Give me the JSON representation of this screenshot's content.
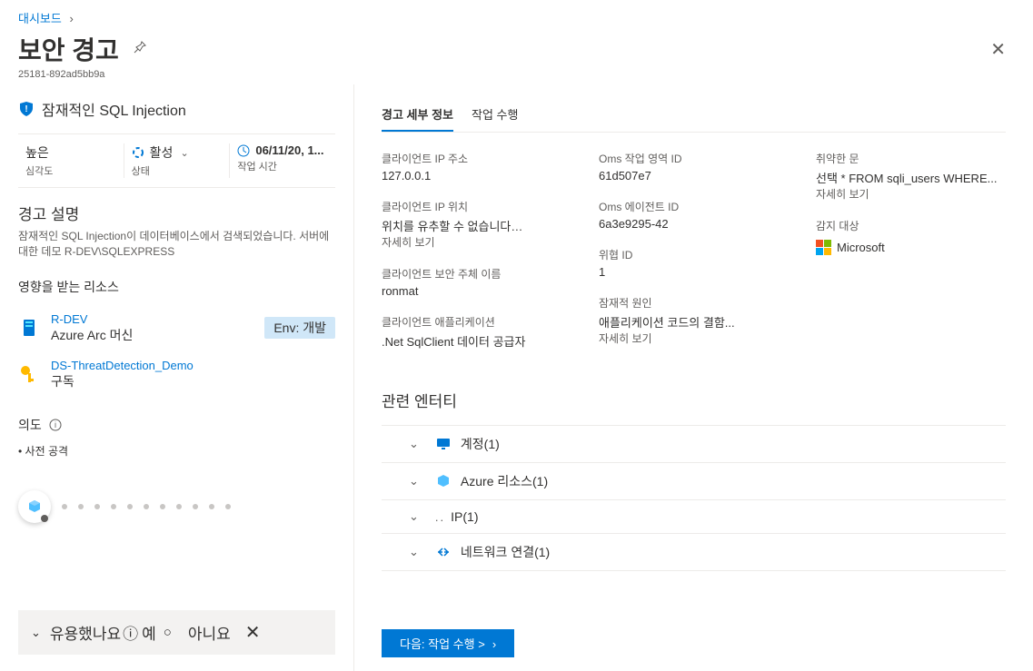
{
  "breadcrumb": {
    "item": "대시보드"
  },
  "title": "보안 경고",
  "subtitle": "25181-892ad5bb9a",
  "alert_title": "잠재적인 SQL Injection",
  "info": {
    "severity_value": "높은",
    "severity_label": "심각도",
    "status_value": "활성",
    "status_label": "상태",
    "time_value": "06/11/20, 1...",
    "time_label": "작업 시간"
  },
  "description": {
    "heading": "경고 설명",
    "text": "잠재적인 SQL Injection이 데이터베이스에서 검색되었습니다. 서버에 대한 데모 R-DEV\\SQLEXPRESS"
  },
  "affected_label": "영향을 받는 리소스",
  "resources": [
    {
      "name": "R-DEV",
      "type": "Azure Arc 머신",
      "tag": "Env: 개발"
    },
    {
      "name": "DS-ThreatDetection_Demo",
      "type": "구독",
      "tag": ""
    }
  ],
  "intent_label": "의도",
  "intent_bullet": "사전 공격",
  "feedback": {
    "question": "유용했나요",
    "yes": "예",
    "no": "아니요"
  },
  "tabs": {
    "details": "경고 세부 정보",
    "actions": "작업 수행"
  },
  "details": {
    "client_ip_label": "클라이언트 IP 주소",
    "client_ip_value": "127.0.0.1",
    "client_loc_label": "클라이언트 IP 위치",
    "client_loc_value": "위치를 유추할 수 없습니다…",
    "client_loc_more": "자세히 보기",
    "client_principal_label": "클라이언트 보안 주체 이름",
    "client_principal_value": "ronmat",
    "client_app_label": "클라이언트 애플리케이션",
    "client_app_value": ".Net SqlClient 데이터 공급자",
    "oms_workspace_label": "Oms 작업 영역 ID",
    "oms_workspace_value": "61d507e7",
    "oms_agent_label": "Oms 에이전트 ID",
    "oms_agent_value": "6a3e9295-42",
    "threat_id_label": "위협 ID",
    "threat_id_value": "1",
    "potential_cause_label": "잠재적 원인",
    "potential_cause_value": "애플리케이션 코드의 결함...",
    "potential_cause_more": "자세히 보기",
    "vulnerable_stmt_label": "취약한 문",
    "vulnerable_stmt_value": "선택 * FROM sqli_users WHERE...",
    "vulnerable_stmt_more": "자세히 보기",
    "detected_by_label": "감지 대상",
    "detected_by_value": "Microsoft"
  },
  "entities": {
    "heading": "관련 엔터티",
    "rows": [
      {
        "name": "계정",
        "count": "(1)"
      },
      {
        "name": "Azure 리소스",
        "count": "(1)"
      },
      {
        "name": "IP",
        "count": "(1)"
      },
      {
        "name": "네트워크 연결",
        "count": "(1)"
      }
    ]
  },
  "footer_btn": "다음: 작업 수행 >"
}
